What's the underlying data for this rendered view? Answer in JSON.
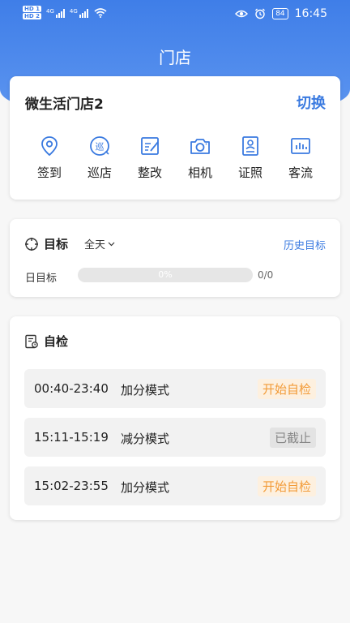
{
  "status_bar": {
    "sim1": "HD 1",
    "sim2": "HD 2",
    "net1": "4G",
    "net2": "4G",
    "battery": "84",
    "time": "16:45"
  },
  "header": {
    "title": "门店"
  },
  "store": {
    "name": "微生活门店2",
    "switch_label": "切换",
    "actions": [
      {
        "label": "签到",
        "icon": "location-pin-icon"
      },
      {
        "label": "巡店",
        "icon": "patrol-icon"
      },
      {
        "label": "整改",
        "icon": "rectify-icon"
      },
      {
        "label": "相机",
        "icon": "camera-icon"
      },
      {
        "label": "证照",
        "icon": "license-icon"
      },
      {
        "label": "客流",
        "icon": "traffic-chart-icon"
      }
    ]
  },
  "goal": {
    "title": "目标",
    "range": "全天",
    "history_label": "历史目标",
    "daily_label": "日目标",
    "progress": 0,
    "progress_text": "0%",
    "count_text": "0/0"
  },
  "self_check": {
    "title": "自检",
    "items": [
      {
        "time": "00:40-23:40",
        "mode": "加分模式",
        "status": "开始自检",
        "status_type": "start"
      },
      {
        "time": "15:11-15:19",
        "mode": "减分模式",
        "status": "已截止",
        "status_type": "closed"
      },
      {
        "time": "15:02-23:55",
        "mode": "加分模式",
        "status": "开始自检",
        "status_type": "start"
      }
    ]
  },
  "colors": {
    "primary": "#3a7ae0",
    "header": "#3f7ee8",
    "status_start": "#f29b38",
    "status_closed": "#888888"
  }
}
